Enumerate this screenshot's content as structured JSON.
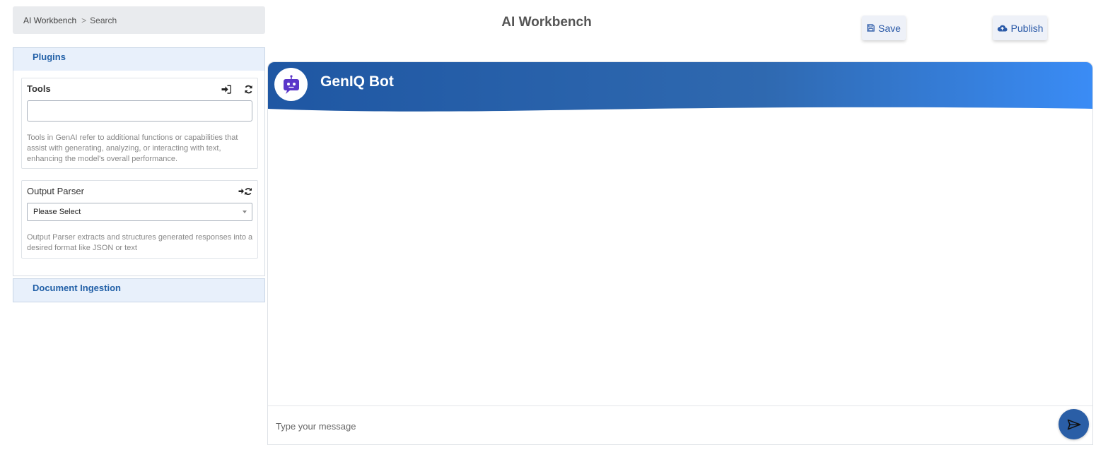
{
  "breadcrumb": {
    "root": "AI Workbench",
    "separator": ">",
    "current": "Search"
  },
  "header": {
    "title": "AI Workbench",
    "save_label": "Save",
    "publish_label": "Publish"
  },
  "sidebar": {
    "plugins_label": "Plugins",
    "tools": {
      "title": "Tools",
      "input_value": "",
      "description": "Tools in GenAI refer to additional functions or capabilities that assist with generating, analyzing, or interacting with text, enhancing the model's overall performance."
    },
    "output_parser": {
      "title": "Output Parser",
      "selected": "Please Select",
      "description": "Output Parser extracts and structures generated responses into a desired format like JSON or text"
    },
    "document_ingestion_label": "Document Ingestion"
  },
  "chat": {
    "bot_name": "GenIQ Bot",
    "input_placeholder": "Type your message",
    "header_colors": [
      "#1f57a3",
      "#3a8cf6"
    ]
  },
  "icons": {
    "save": "floppy-disk-icon",
    "publish": "cloud-upload-icon",
    "import": "sign-in-icon",
    "refresh": "refresh-icon",
    "bot": "robot-icon",
    "send": "send-icon"
  }
}
